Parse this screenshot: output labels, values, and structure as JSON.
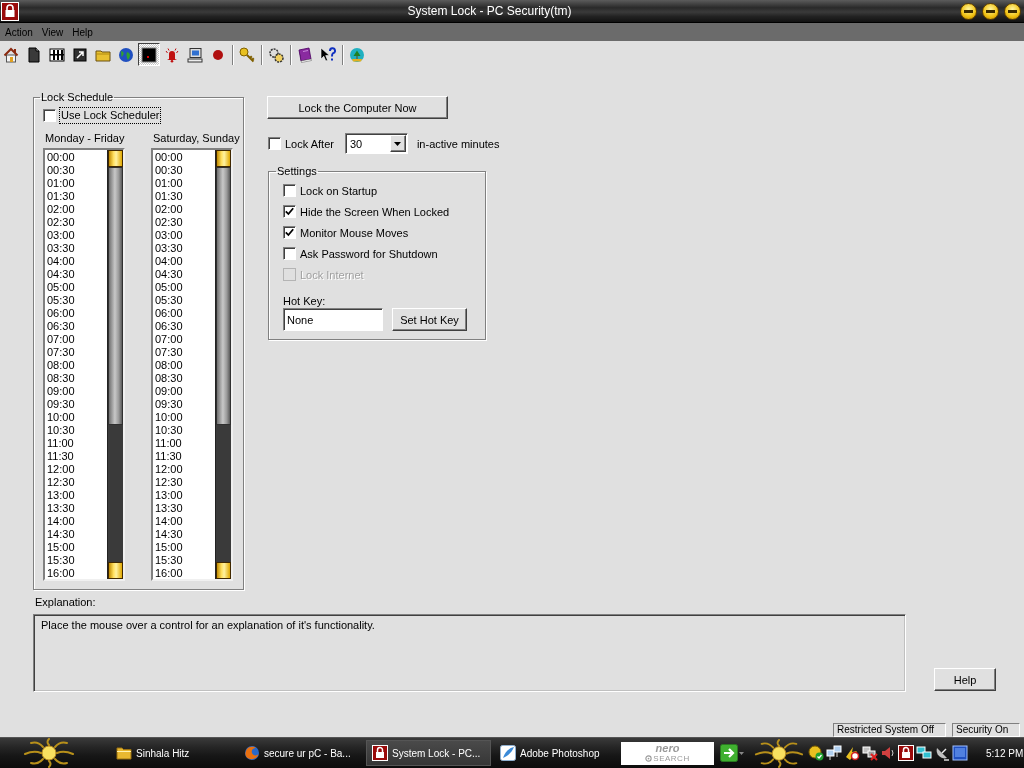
{
  "window": {
    "title": "System Lock - PC Security(tm)"
  },
  "menu": [
    "Action",
    "View",
    "Help"
  ],
  "toolbar": [
    {
      "selected": false
    },
    {
      "selected": false
    },
    {
      "selected": false
    },
    {
      "selected": false
    },
    {
      "selected": false
    },
    {
      "selected": false
    },
    {
      "selected": true
    },
    {
      "selected": false
    },
    {
      "selected": false
    },
    {
      "selected": false
    },
    {
      "selected": false
    },
    {
      "selected": false
    },
    {
      "selected": false
    },
    {
      "selected": false
    },
    {
      "selected": false
    }
  ],
  "lock_schedule": {
    "title": "Lock Schedule",
    "use_scheduler": {
      "label": "Use Lock Scheduler",
      "checked": false,
      "focused": true
    },
    "lists": [
      {
        "heading": "Monday - Friday",
        "items": [
          "00:00",
          "00:30",
          "01:00",
          "01:30",
          "02:00",
          "02:30",
          "03:00",
          "03:30",
          "04:00",
          "04:30",
          "05:00",
          "05:30",
          "06:00",
          "06:30",
          "07:00",
          "07:30",
          "08:00",
          "08:30",
          "09:00",
          "09:30",
          "10:00",
          "10:30",
          "11:00",
          "11:30",
          "12:00",
          "12:30",
          "13:00",
          "13:30",
          "14:00",
          "14:30",
          "15:00",
          "15:30",
          "16:00"
        ]
      },
      {
        "heading": "Saturday, Sunday",
        "items": [
          "00:00",
          "00:30",
          "01:00",
          "01:30",
          "02:00",
          "02:30",
          "03:00",
          "03:30",
          "04:00",
          "04:30",
          "05:00",
          "05:30",
          "06:00",
          "06:30",
          "07:00",
          "07:30",
          "08:00",
          "08:30",
          "09:00",
          "09:30",
          "10:00",
          "10:30",
          "11:00",
          "11:30",
          "12:00",
          "12:30",
          "13:00",
          "13:30",
          "14:00",
          "14:30",
          "15:00",
          "15:30",
          "16:00"
        ]
      }
    ]
  },
  "lock_now_button": {
    "label": "Lock the Computer Now"
  },
  "lock_after": {
    "label": "Lock After",
    "checked": false,
    "minutes": "30",
    "suffix": "in-active minutes"
  },
  "settings": {
    "title": "Settings",
    "options": [
      {
        "label": "Lock on Startup",
        "checked": false,
        "disabled": false
      },
      {
        "label": "Hide the Screen When Locked",
        "checked": true,
        "disabled": false
      },
      {
        "label": "Monitor Mouse Moves",
        "checked": true,
        "disabled": false
      },
      {
        "label": "Ask Password for Shutdown",
        "checked": false,
        "disabled": false
      },
      {
        "label": "Lock Internet",
        "checked": false,
        "disabled": true
      }
    ],
    "hot_key": {
      "label": "Hot Key:",
      "value": "None"
    },
    "set_hot_key_button": {
      "label": "Set Hot Key"
    }
  },
  "explanation": {
    "label": "Explanation:",
    "text": "Place the mouse over a control for an explanation of it's functionality."
  },
  "help_button": {
    "label": "Help"
  },
  "status_bar": [
    "Restricted System Off",
    "Security On"
  ],
  "taskbar": {
    "tasks": [
      {
        "label": "Sinhala Hitz",
        "selected": false
      },
      {
        "label": "secure ur pC - Ba...",
        "selected": false
      },
      {
        "label": "System Lock - PC...",
        "selected": true
      },
      {
        "label": "Adobe Photoshop",
        "selected": false
      }
    ],
    "search_field": {
      "logo": "nero",
      "tagline": "SEARCH"
    },
    "clock": "5:12 PM"
  }
}
